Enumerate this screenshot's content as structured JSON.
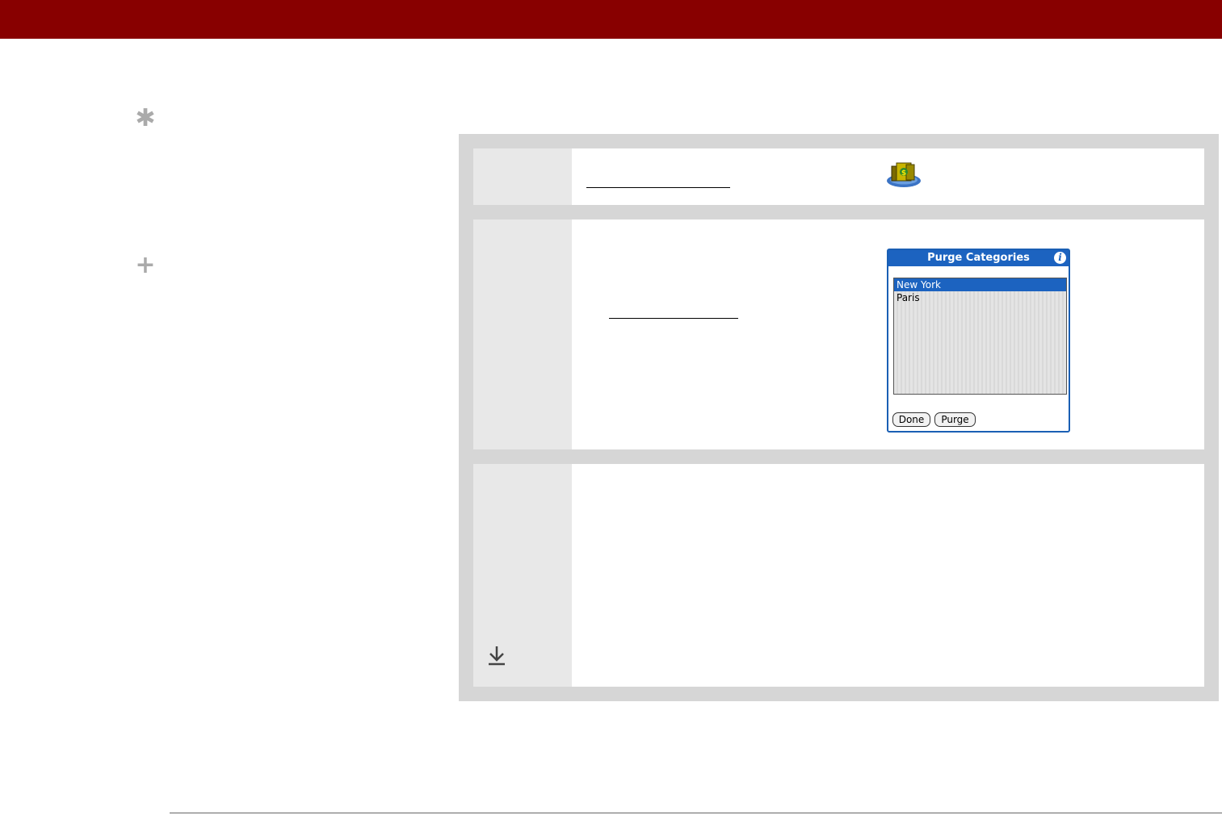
{
  "colors": {
    "header_bar": "#880000",
    "panel": "#d6d6d6",
    "step_number_cell": "#e8e8e8",
    "dialog_blue": "#1c63c0"
  },
  "sidebar": {
    "tip_icon": "asterisk-icon",
    "more_icon": "plus-icon"
  },
  "steps": {
    "step1": {
      "app_icon": "expense-app-icon"
    },
    "step2": {
      "dialog": {
        "title": "Purge Categories",
        "items": [
          "New York",
          "Paris"
        ],
        "selected_item": "New York",
        "done_label": "Done",
        "purge_label": "Purge"
      }
    },
    "step3": {
      "icon": "down-arrow-icon"
    }
  }
}
